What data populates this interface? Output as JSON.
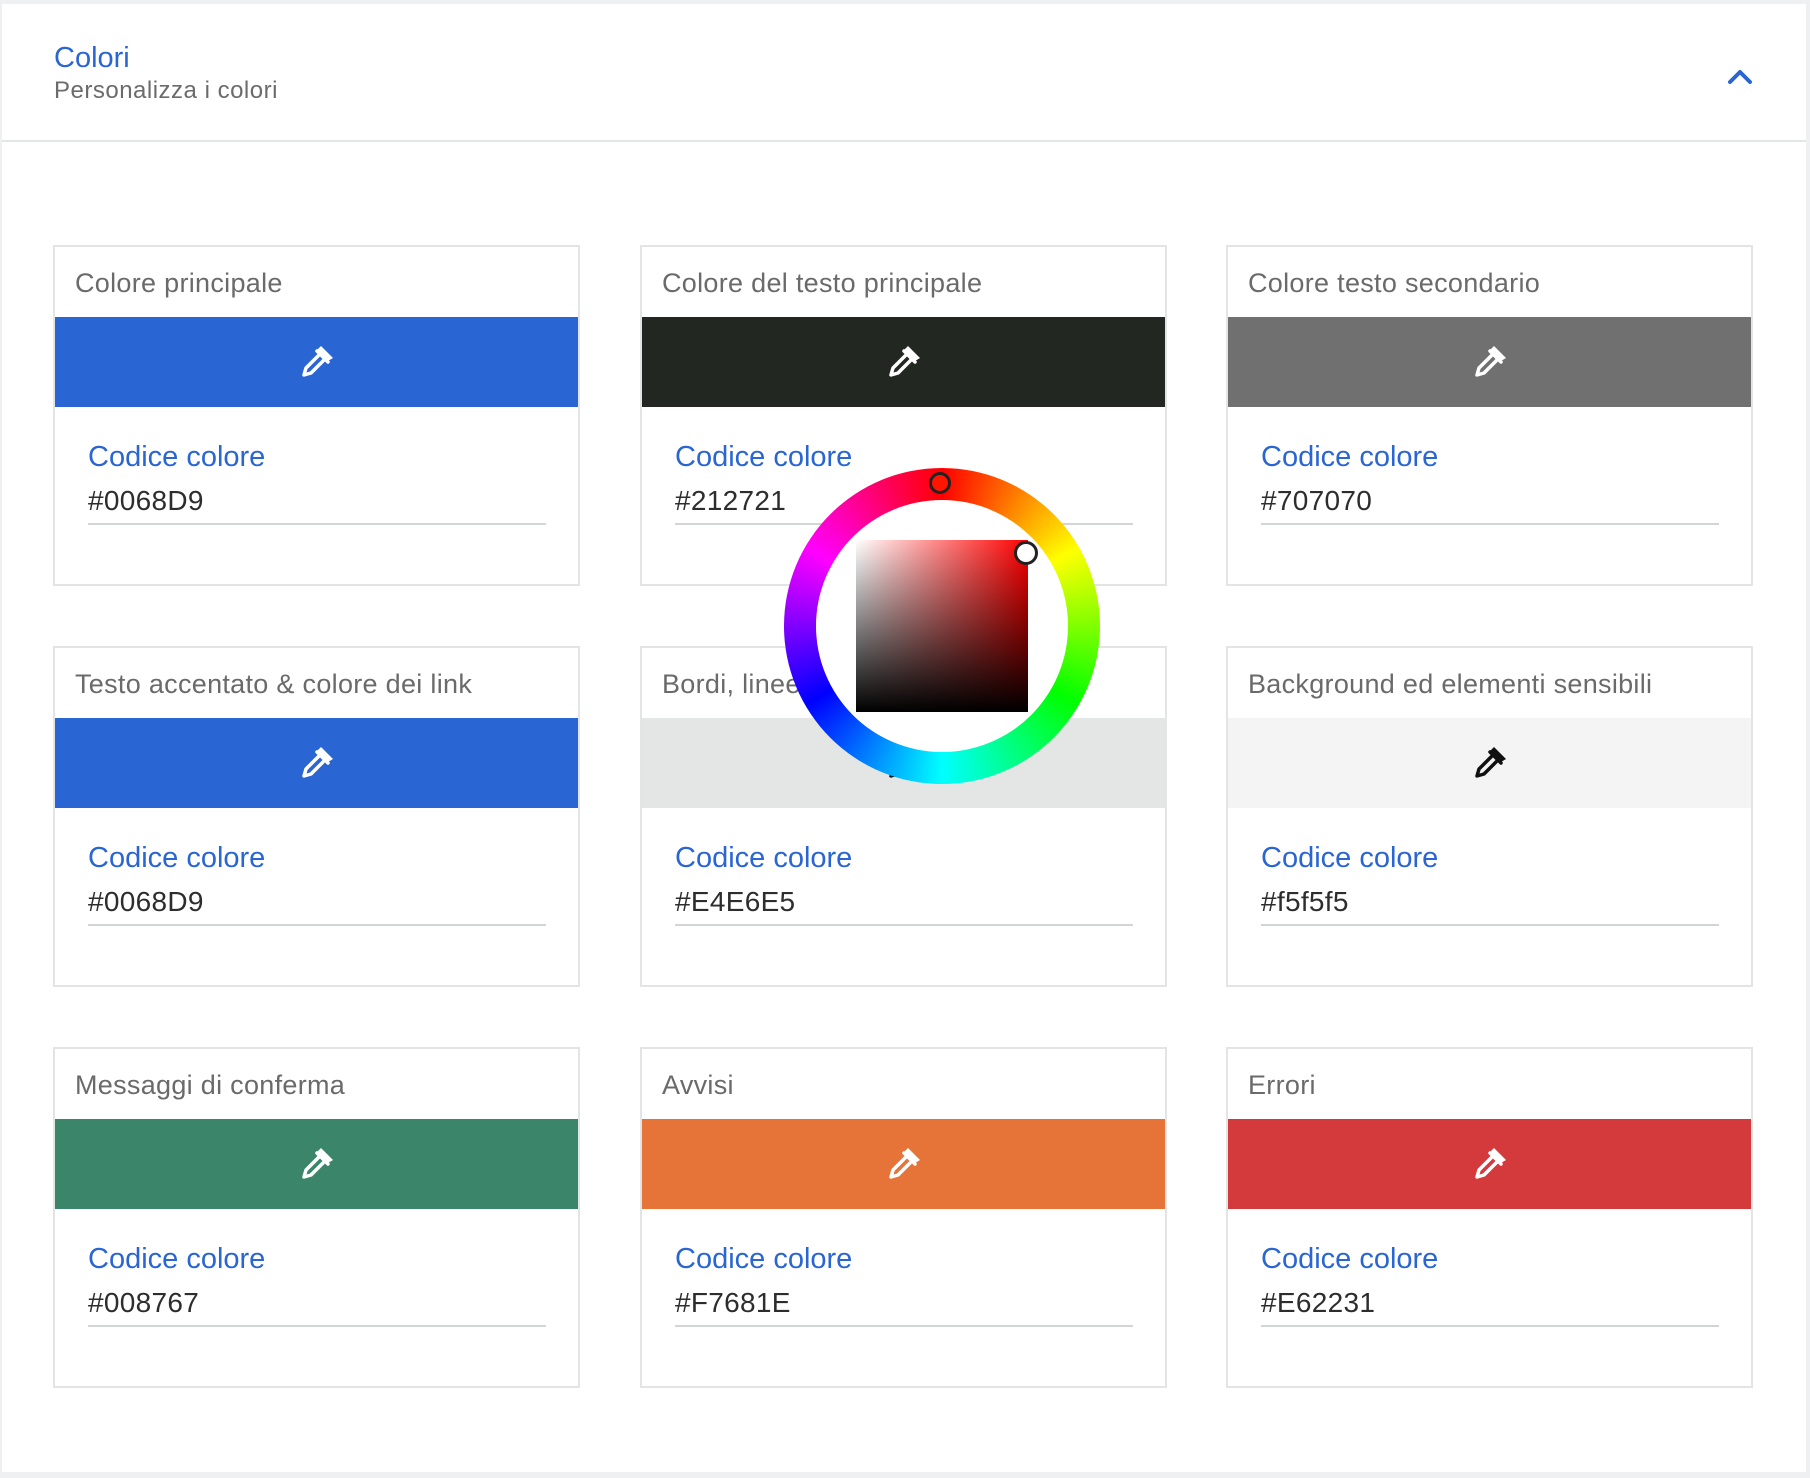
{
  "section": {
    "title": "Colori",
    "subtitle": "Personalizza i colori",
    "collapse_icon": "chevron-up-icon",
    "accent_color": "#2a65d4"
  },
  "code_label": "Codice colore",
  "eyedropper_icon": "eyedropper-icon",
  "cards": [
    {
      "title": "Colore principale",
      "code": "#0068D9",
      "swatch_color": "#2a65d4",
      "icon_color": "#ffffff"
    },
    {
      "title": "Colore del testo principale",
      "code": "#212721",
      "swatch_color": "#222722",
      "icon_color": "#ffffff"
    },
    {
      "title": "Colore testo secondario",
      "code": "#707070",
      "swatch_color": "#707070",
      "icon_color": "#ffffff"
    },
    {
      "title": "Testo accentato & colore dei link",
      "code": "#0068D9",
      "swatch_color": "#2a65d4",
      "icon_color": "#ffffff"
    },
    {
      "title": "Bordi, linee",
      "code": "#E4E6E5",
      "swatch_color": "#e4e6e5",
      "icon_color": "#111111"
    },
    {
      "title": "Background ed elementi sensibili",
      "code": "#f5f5f5",
      "swatch_color": "#f4f4f4",
      "icon_color": "#111111"
    },
    {
      "title": "Messaggi di conferma",
      "code": "#008767",
      "swatch_color": "#3b866b",
      "icon_color": "#ffffff"
    },
    {
      "title": "Avvisi",
      "code": "#F7681E",
      "swatch_color": "#e67337",
      "icon_color": "#ffffff"
    },
    {
      "title": "Errori",
      "code": "#E62231",
      "swatch_color": "#d43a3b",
      "icon_color": "#ffffff"
    }
  ],
  "color_picker": {
    "open_for": "Colore del testo principale",
    "hue_selected": "#ff1500",
    "saturation": 1.0,
    "value": 1.0
  }
}
